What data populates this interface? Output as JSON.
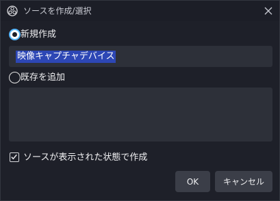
{
  "window": {
    "title": "ソースを作成/選択",
    "app_icon": "obs-logo-icon",
    "close_icon": "close-icon"
  },
  "create_new": {
    "label": "新規作成",
    "selected": true,
    "name_value": "映像キャプチャデバイス"
  },
  "add_existing": {
    "label": "既存を追加",
    "selected": false,
    "items": []
  },
  "visible_checkbox": {
    "label": "ソースが表示された状態で作成",
    "checked": true
  },
  "buttons": {
    "ok": "OK",
    "cancel": "キャンセル"
  },
  "colors": {
    "accent": "#56b7ff",
    "selection": "#2d47b5",
    "field_bg": "#2d3039",
    "dialog_bg": "#1e2029"
  }
}
